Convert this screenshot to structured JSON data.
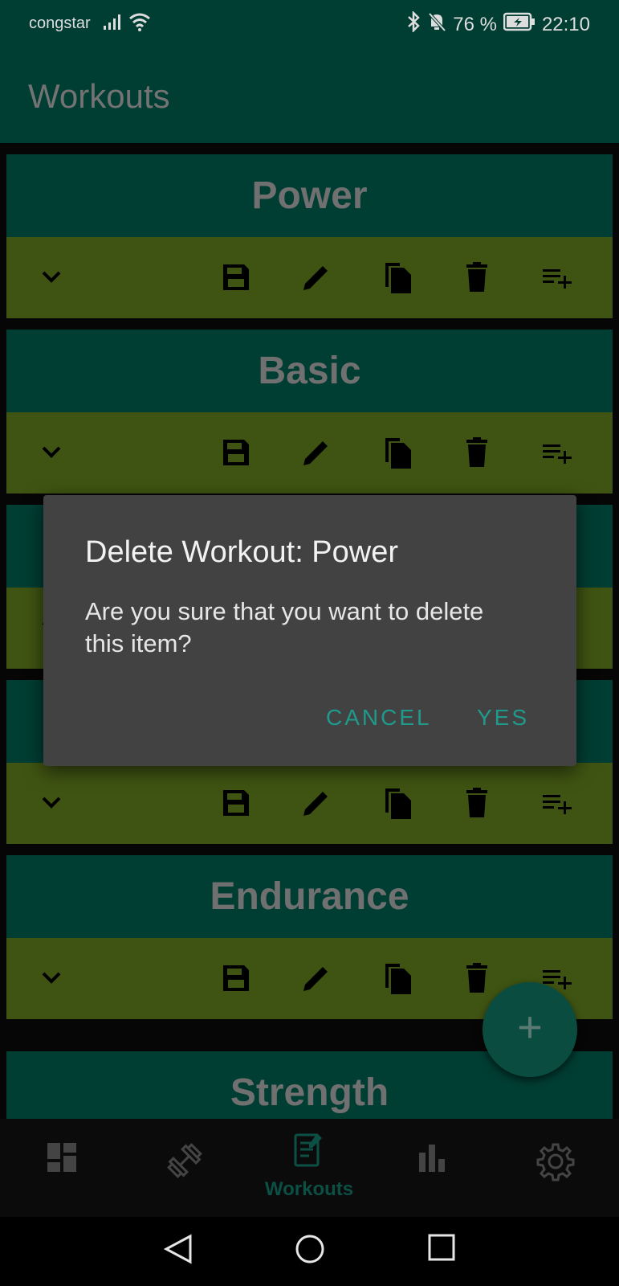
{
  "status_bar": {
    "carrier": "congstar",
    "battery": "76 %",
    "time": "22:10"
  },
  "appbar": {
    "title": "Workouts"
  },
  "workouts": [
    {
      "name": "Power"
    },
    {
      "name": "Basic"
    },
    {
      "name": ""
    },
    {
      "name": ""
    },
    {
      "name": "Endurance"
    },
    {
      "name": "Strength"
    }
  ],
  "dialog": {
    "title": "Delete Workout: Power",
    "message": "Are you sure that you want to delete this item?",
    "cancel_label": "CANCEL",
    "yes_label": "YES"
  },
  "fab": {
    "label": "+"
  },
  "bottom_nav": {
    "active_label": "Workouts",
    "items": [
      "dashboard-icon",
      "dumbbell-icon",
      "workouts-icon",
      "bar-chart-icon",
      "settings-icon"
    ]
  },
  "colors": {
    "header_bg": "#003d33",
    "card_head": "#003d33",
    "card_bar": "#3f5412",
    "accent": "#1f9a8b",
    "dialog_bg": "#424242"
  }
}
